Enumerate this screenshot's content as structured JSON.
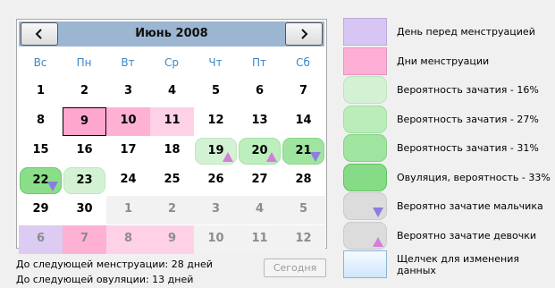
{
  "calendar": {
    "title": "Июнь 2008",
    "prev_icon": "‹",
    "next_icon": "›",
    "weekdays": [
      "Вс",
      "Пн",
      "Вт",
      "Ср",
      "Чт",
      "Пт",
      "Сб"
    ],
    "rows": [
      [
        {
          "d": "1",
          "t": ""
        },
        {
          "d": "2",
          "t": ""
        },
        {
          "d": "3",
          "t": ""
        },
        {
          "d": "4",
          "t": ""
        },
        {
          "d": "5",
          "t": ""
        },
        {
          "d": "6",
          "t": ""
        },
        {
          "d": "7",
          "t": ""
        }
      ],
      [
        {
          "d": "8",
          "t": ""
        },
        {
          "d": "9",
          "t": "sel"
        },
        {
          "d": "10",
          "t": "menses"
        },
        {
          "d": "11",
          "t": "menses-light"
        },
        {
          "d": "12",
          "t": ""
        },
        {
          "d": "13",
          "t": ""
        },
        {
          "d": "14",
          "t": ""
        }
      ],
      [
        {
          "d": "15",
          "t": ""
        },
        {
          "d": "16",
          "t": ""
        },
        {
          "d": "17",
          "t": ""
        },
        {
          "d": "18",
          "t": ""
        },
        {
          "d": "19",
          "t": "p16",
          "m": "up"
        },
        {
          "d": "20",
          "t": "p27",
          "m": "up"
        },
        {
          "d": "21",
          "t": "p31",
          "m": "down"
        }
      ],
      [
        {
          "d": "22",
          "t": "ov",
          "m": "down"
        },
        {
          "d": "23",
          "t": "p16"
        },
        {
          "d": "24",
          "t": ""
        },
        {
          "d": "25",
          "t": ""
        },
        {
          "d": "26",
          "t": ""
        },
        {
          "d": "27",
          "t": ""
        },
        {
          "d": "28",
          "t": ""
        }
      ],
      [
        {
          "d": "29",
          "t": ""
        },
        {
          "d": "30",
          "t": ""
        },
        {
          "d": "1",
          "t": "other"
        },
        {
          "d": "2",
          "t": "other"
        },
        {
          "d": "3",
          "t": "other"
        },
        {
          "d": "4",
          "t": "other"
        },
        {
          "d": "5",
          "t": "other"
        }
      ],
      [
        {
          "d": "6",
          "t": "other before"
        },
        {
          "d": "7",
          "t": "other menses"
        },
        {
          "d": "8",
          "t": "other menses-light"
        },
        {
          "d": "9",
          "t": "other menses-light"
        },
        {
          "d": "10",
          "t": "other"
        },
        {
          "d": "11",
          "t": "other"
        },
        {
          "d": "12",
          "t": "other"
        }
      ]
    ]
  },
  "info": {
    "next_menses": "До следующей менструации: 28 дней",
    "next_ovulation": "До следующей овуляции: 13 дней",
    "today_label": "Сегодня"
  },
  "legend": {
    "items": [
      {
        "label": "День перед менструацией",
        "swatch": "sw-before"
      },
      {
        "label": "Дни менструации",
        "swatch": "sw-menses"
      },
      {
        "label": "Вероятность зачатия - 16%",
        "swatch": "sw-p16"
      },
      {
        "label": "Вероятность зачатия - 27%",
        "swatch": "sw-p27"
      },
      {
        "label": "Вероятность зачатия - 31%",
        "swatch": "sw-p31"
      },
      {
        "label": "Овуляция, вероятность - 33%",
        "swatch": "sw-ov"
      },
      {
        "label": "Вероятно зачатие мальчика",
        "swatch": "sw-gray",
        "marker": "down"
      },
      {
        "label": "Вероятно зачатие девочки",
        "swatch": "sw-gray",
        "marker": "up"
      },
      {
        "label": "Щелчек для изменения данных",
        "swatch": "sw-click"
      }
    ]
  },
  "colors": {
    "header": "#9cb6d2",
    "weekday_text": "#3a87c8",
    "menses": "#ffb1d4",
    "before_menses": "#dccbf2",
    "ovulation": "#8ade8a",
    "boy_marker": "#8c7de0",
    "girl_marker": "#d47ed8"
  }
}
